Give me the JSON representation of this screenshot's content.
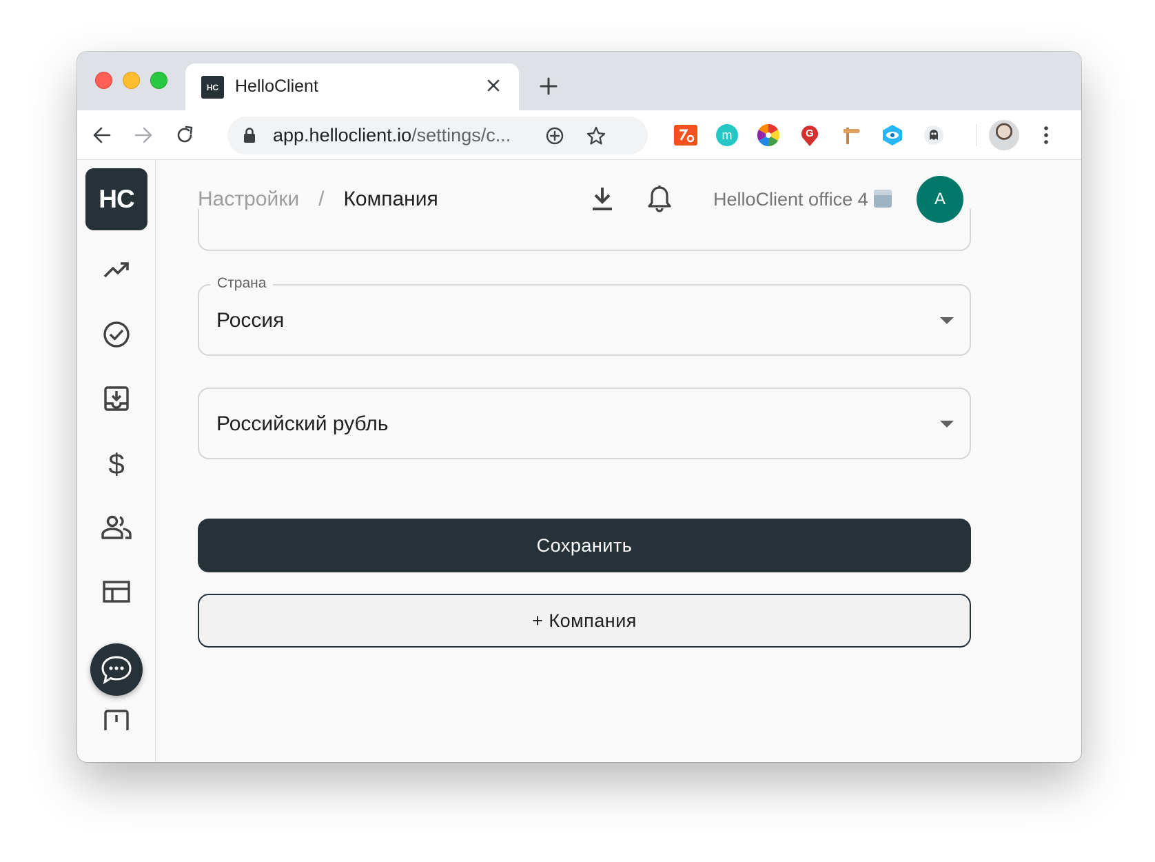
{
  "browser": {
    "tab": {
      "favicon_text": "HC",
      "title": "HelloClient"
    },
    "url": {
      "host": "app.helloclient.io",
      "path": "/settings/c..."
    }
  },
  "sidebar": {
    "logo_text": "HC",
    "items": [
      {
        "icon": "trending-up-icon"
      },
      {
        "icon": "check-circle-icon"
      },
      {
        "icon": "inbox-download-icon"
      },
      {
        "icon": "dollar-icon"
      },
      {
        "icon": "people-icon"
      },
      {
        "icon": "table-icon"
      }
    ]
  },
  "header": {
    "breadcrumb": {
      "parent": "Настройки",
      "separator": "/",
      "current": "Компания"
    },
    "org_name": "HelloClient office 4",
    "avatar_letter": "A"
  },
  "form": {
    "country": {
      "label": "Страна",
      "value": "Россия"
    },
    "currency": {
      "value": "Российский рубль"
    },
    "save_label": "Сохранить",
    "add_company_label": "+ Компания"
  },
  "colors": {
    "primary": "#263238",
    "avatar": "#00796b"
  }
}
